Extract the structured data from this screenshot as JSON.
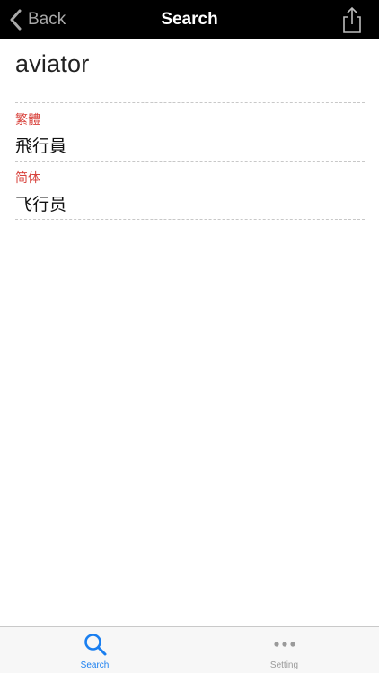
{
  "navbar": {
    "back_label": "Back",
    "title": "Search",
    "back_icon": "chevron-left-icon",
    "share_icon": "share-icon"
  },
  "entry": {
    "term": "aviator",
    "sections": [
      {
        "label": "繁體",
        "value": "飛行員"
      },
      {
        "label": "简体",
        "value": "飞行员"
      }
    ]
  },
  "tabbar": {
    "tabs": [
      {
        "label": "Search",
        "icon": "search-icon",
        "selected": true
      },
      {
        "label": "Setting",
        "icon": "more-icon",
        "selected": false
      }
    ]
  },
  "colors": {
    "navbar_bg": "#000000",
    "accent_red": "#d8433d",
    "tab_active": "#1a7ff0",
    "tab_inactive": "#9a9a9a"
  }
}
